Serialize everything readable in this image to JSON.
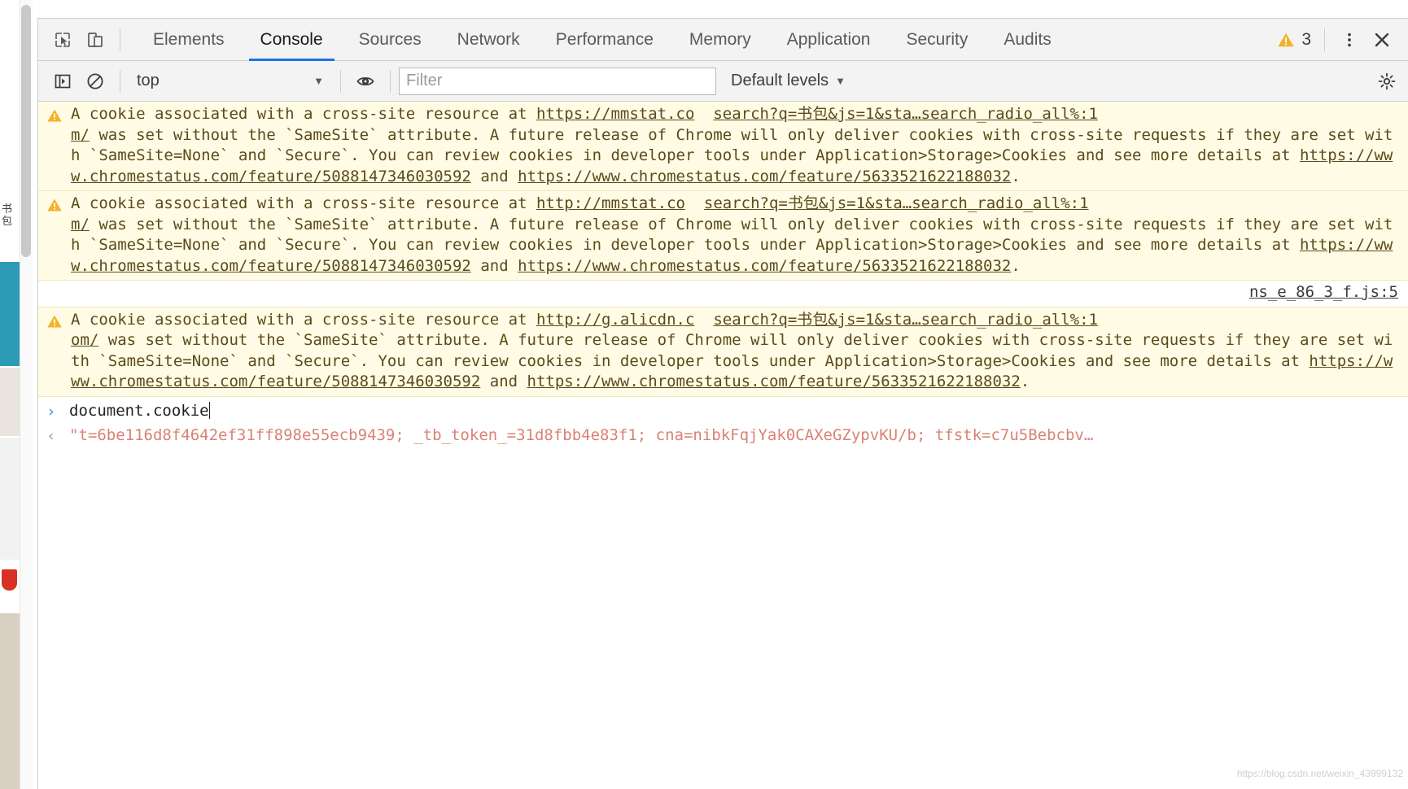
{
  "tabbar": {
    "inspect_icon": "inspect-cursor-icon",
    "device_icon": "device-toolbar-icon",
    "tabs": [
      {
        "label": "Elements",
        "active": false
      },
      {
        "label": "Console",
        "active": true
      },
      {
        "label": "Sources",
        "active": false
      },
      {
        "label": "Network",
        "active": false
      },
      {
        "label": "Performance",
        "active": false
      },
      {
        "label": "Memory",
        "active": false
      },
      {
        "label": "Application",
        "active": false
      },
      {
        "label": "Security",
        "active": false
      },
      {
        "label": "Audits",
        "active": false
      }
    ],
    "warning_count": "3",
    "warning_icon": "warning-triangle-icon",
    "menu_icon": "kebab-menu-icon",
    "close_icon": "close-icon"
  },
  "filterbar": {
    "sidebar_toggle_icon": "console-sidebar-toggle-icon",
    "clear_icon": "clear-console-icon",
    "context_value": "top",
    "eye_icon": "live-expression-eye-icon",
    "filter_placeholder": "Filter",
    "filter_value": "",
    "levels_label": "Default levels",
    "gear_icon": "settings-gear-icon",
    "caret": "▼"
  },
  "console": {
    "messages": [
      {
        "kind": "warning",
        "icon": "warning-triangle-icon",
        "pre": "A cookie associated with a cross-site resource at ",
        "link1": "https://mmstat.co",
        "gap": "  ",
        "link2": "search?q=书包&js=1&sta…search_radio_all%:1\nm/",
        "post": " was set without the `SameSite` attribute. A future release of Chrome will only deliver cookies with cross-site requests if they are set with `SameSite=None` and `Secure`. You can review cookies in developer tools under Application>Storage>Cookies and see more details at ",
        "link3": "https://www.chromestatus.com/feature/5088147346030592",
        "mid": " and ",
        "link4": "https://www.chromestatus.com/feature/5633521622188032",
        "tail": "."
      },
      {
        "kind": "warning",
        "icon": "warning-triangle-icon",
        "pre": "A cookie associated with a cross-site resource at ",
        "link1": "http://mmstat.co",
        "gap": "  ",
        "link2": "search?q=书包&js=1&sta…search_radio_all%:1\nm/",
        "post": " was set without the `SameSite` attribute. A future release of Chrome will only deliver cookies with cross-site requests if they are set with `SameSite=None` and `Secure`. You can review cookies in developer tools under Application>Storage>Cookies and see more details at ",
        "link3": "https://www.chromestatus.com/feature/5088147346030592",
        "mid": " and ",
        "link4": "https://www.chromestatus.com/feature/5633521622188032",
        "tail": "."
      }
    ],
    "source_link": "ns_e_86_3_f.js:5",
    "third_message": {
      "kind": "warning",
      "icon": "warning-triangle-icon",
      "pre": "A cookie associated with a cross-site resource at ",
      "link1": "http://g.alicdn.c",
      "gap": "  ",
      "link2": "search?q=书包&js=1&sta…search_radio_all%:1\nom/",
      "post": " was set without the `SameSite` attribute. A future release of Chrome will only deliver cookies with cross-site requests if they are set with `SameSite=None` and `Secure`. You can review cookies in developer tools under Application>Storage>Cookies and see more details at ",
      "link3": "https://www.chromestatus.com/feature/5088147346030592",
      "mid": " and ",
      "link4": "https://www.chromestatus.com/feature/5633521622188032",
      "tail": "."
    },
    "prompt_arrow": "›",
    "input_value": "document.cookie",
    "result_arrow": "‹",
    "result_value": "\"t=6be116d8f4642ef31ff898e55ecb9439; _tb_token_=31d8fbb4e83f1; cna=nibkFqjYak0CAXeGZypvKU/b; tfstk=c7u5Bebcbv…"
  },
  "page_remnant": {
    "cjk_text": "书包"
  },
  "watermark": "https://blog.csdn.net/weixin_43999132",
  "colors": {
    "accent": "#1a73e8",
    "warning_bg": "#fffbe5",
    "warning_text": "#5c4b1a",
    "result_text": "#d98273",
    "prompt_arrow": "#4285f4"
  }
}
